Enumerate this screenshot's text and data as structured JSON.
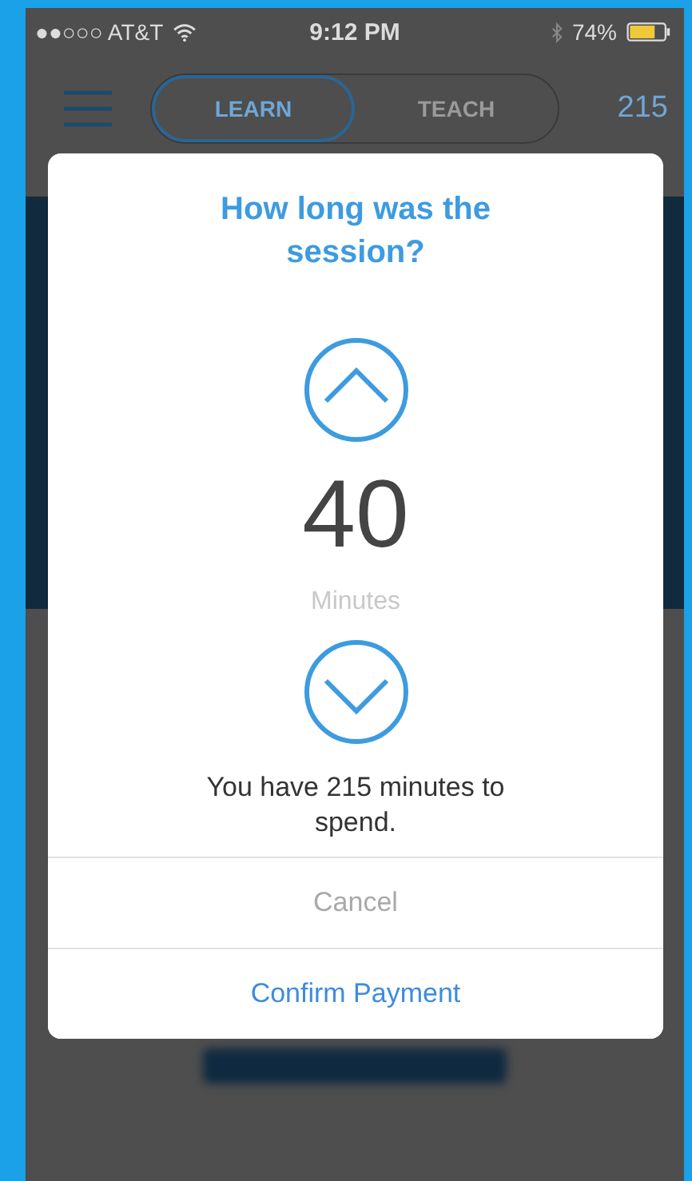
{
  "status_bar": {
    "carrier": "●●○○○ AT&T",
    "time": "9:12 PM",
    "battery": "74%"
  },
  "header": {
    "tabs": [
      {
        "label": "LEARN",
        "selected": true
      },
      {
        "label": "TEACH",
        "selected": false
      }
    ],
    "count": "215"
  },
  "dialog": {
    "title": "How long was the session?",
    "value": "40",
    "unit": "Minutes",
    "message": "You have 215 minutes to spend.",
    "actions": [
      {
        "label": "Cancel",
        "kind": "cancel"
      },
      {
        "label": "Confirm Payment",
        "kind": "confirm"
      }
    ]
  }
}
